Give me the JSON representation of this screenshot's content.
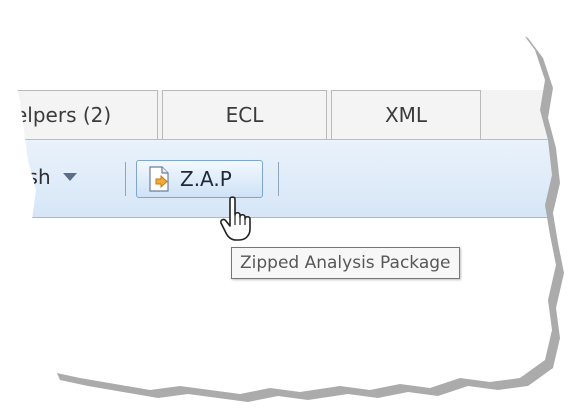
{
  "tabs": [
    {
      "label": "elpers (2)"
    },
    {
      "label": "ECL"
    },
    {
      "label": "XML"
    }
  ],
  "toolbar": {
    "partial_label": "ish",
    "zap_label": "Z.A.P",
    "zap_icon": "document-export-icon"
  },
  "tooltip": {
    "text": "Zipped Analysis Package"
  },
  "cursor": {
    "icon": "hand-pointer-icon"
  },
  "colors": {
    "toolbar_top": "#eaf2fb",
    "toolbar_bottom": "#d6e6f7",
    "button_border": "#7ea6cf",
    "tab_border": "#b9b9b9"
  }
}
